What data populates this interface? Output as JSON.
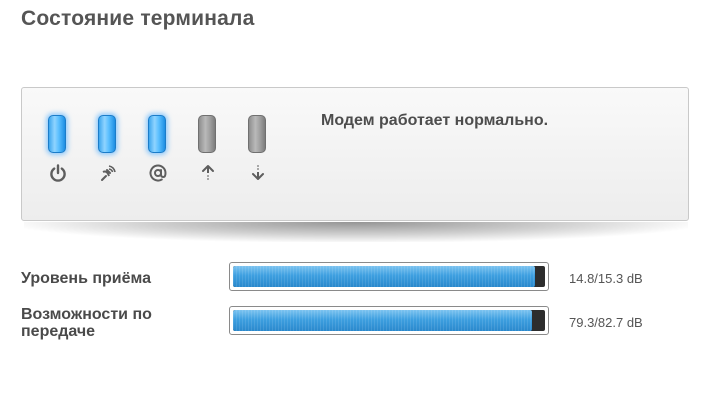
{
  "page": {
    "title": "Состояние терминала"
  },
  "status_panel": {
    "message": "Модем работает нормально.",
    "indicators": [
      {
        "icon": "power-icon",
        "state": "on"
      },
      {
        "icon": "satellite-icon",
        "state": "on"
      },
      {
        "icon": "at-sign-icon",
        "state": "on"
      },
      {
        "icon": "upload-arrow-icon",
        "state": "off"
      },
      {
        "icon": "download-arrow-icon",
        "state": "off"
      }
    ]
  },
  "metrics": {
    "receive_level": {
      "label": "Уровень приёма",
      "value": "14.8/15.3 dB",
      "fill_fraction": 0.967
    },
    "transmit_capability": {
      "label": "Возможности по передаче",
      "value": "79.3/82.7 dB",
      "fill_fraction": 0.959
    }
  },
  "colors": {
    "led_on": "#5cc0ff",
    "led_off": "#a3a3a3",
    "bar_fill": "#3d9fe0",
    "bar_track": "#2d2d2d"
  }
}
